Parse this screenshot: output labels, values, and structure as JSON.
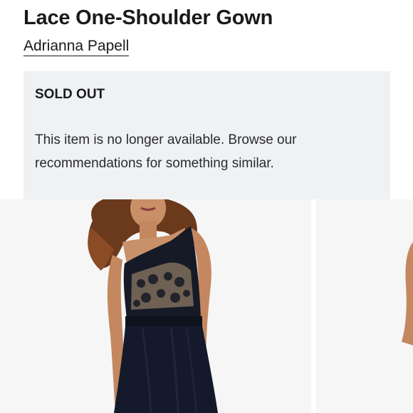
{
  "product": {
    "title": "Lace One-Shoulder Gown",
    "brand": "Adrianna Papell"
  },
  "notice": {
    "heading": "SOLD OUT",
    "message": "This item is no longer available. Browse our recommendations for something similar."
  },
  "gallery": {
    "images": [
      {
        "name": "product-image-main",
        "alt": "Model wearing a black lace one-shoulder gown"
      },
      {
        "name": "product-image-next",
        "alt": "Next product image"
      }
    ]
  },
  "colors": {
    "notice_bg": "#f0f1f3",
    "text": "#191a1b",
    "image_bg": "#f6f6f6",
    "gown": "#161b2a"
  }
}
